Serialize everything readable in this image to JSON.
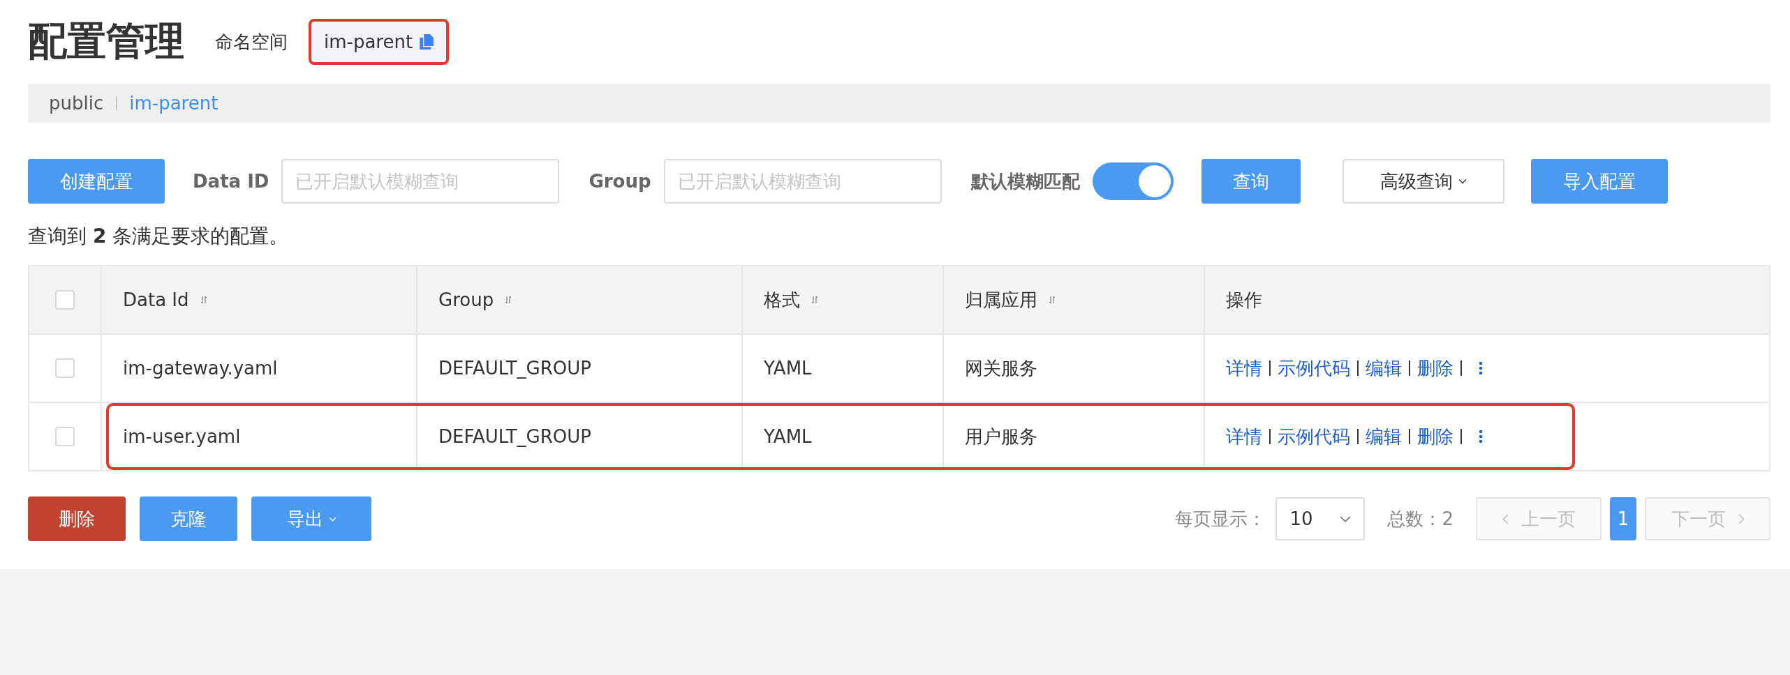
{
  "page_title": "配置管理",
  "namespace": {
    "label": "命名空间",
    "value": "im-parent",
    "highlighted": true
  },
  "breadcrumb": [
    {
      "label": "public",
      "selected": false
    },
    {
      "label": "im-parent",
      "selected": true
    }
  ],
  "toolbar": {
    "create_button": "创建配置",
    "data_id": {
      "label": "Data ID",
      "placeholder": "已开启默认模糊查询"
    },
    "group": {
      "label": "Group",
      "placeholder": "已开启默认模糊查询"
    },
    "fuzzy": {
      "label": "默认模糊匹配",
      "on": true
    },
    "search_button": "查询",
    "advanced_button": "高级查询",
    "import_button": "导入配置"
  },
  "summary": "查询到 **2** 条满足要求的配置。",
  "table": {
    "select_all_checked": false,
    "columns": [
      {
        "label": "Data Id",
        "sortable": true
      },
      {
        "label": "Group",
        "sortable": true
      },
      {
        "label": "格式",
        "sortable": true
      },
      {
        "label": "归属应用",
        "sortable": true
      },
      {
        "label": "操作",
        "sortable": false
      }
    ],
    "rows": [
      {
        "checked": false,
        "highlighted": false,
        "cells": [
          "im-gateway.yaml",
          "DEFAULT_GROUP",
          "YAML",
          "网关服务"
        ],
        "actions": [
          "详情",
          "示例代码",
          "编辑",
          "删除"
        ]
      },
      {
        "checked": false,
        "highlighted": true,
        "cells": [
          "im-user.yaml",
          "DEFAULT_GROUP",
          "YAML",
          "用户服务"
        ],
        "actions": [
          "详情",
          "示例代码",
          "编辑",
          "删除"
        ]
      }
    ]
  },
  "bulk_buttons": [
    {
      "label": "删除",
      "kind": "danger"
    },
    {
      "label": "克隆",
      "kind": "primary"
    },
    {
      "label": "导出",
      "kind": "dropdown"
    }
  ],
  "pagination": {
    "page_size_label": "每页显示：",
    "page_size": "10",
    "total": "总数：2",
    "prev": {
      "label": "上一页",
      "disabled": true
    },
    "pages": [
      {
        "label": "1",
        "selected": true
      }
    ],
    "next": {
      "label": "下一页",
      "disabled": true
    }
  }
}
